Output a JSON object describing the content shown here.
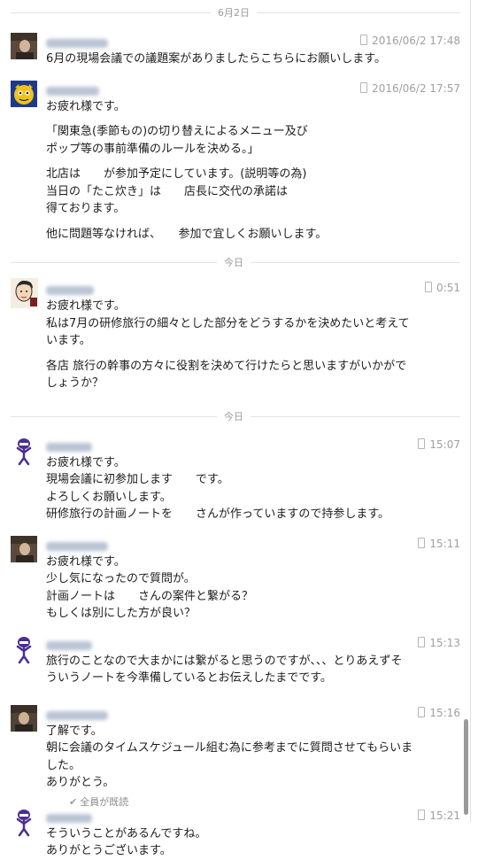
{
  "dividers": {
    "d1": "6月2日",
    "d2": "今日",
    "d3": "今日"
  },
  "messages": [
    {
      "avatar": "photo-avatar-1",
      "time": "2016/06/2 17:48",
      "paragraphs": [
        "6月の現場会議での議題案がありましたらこちらにお願いします。"
      ]
    },
    {
      "avatar": "tiger-avatar",
      "time": "2016/06/2 17:57",
      "paragraphs": [
        "お疲れ様です。",
        "「関東急(季節もの)の切り替えによるメニュー及び\nポップ等の事前準備のルールを決める。」",
        "北店は　　が参加予定にしています。(説明等の為)\n当日の「たこ炊き」は　　店長に交代の承諾は\n得ております。",
        "他に問題等なければ、　　参加で宜しくお願いします。"
      ]
    },
    {
      "avatar": "illustrated-avatar",
      "time": "0:51",
      "paragraphs": [
        "お疲れ様です。\n私は7月の研修旅行の細々とした部分をどうするかを決めたいと考えて\nいます。",
        "各店 旅行の幹事の方々に役割を決めて行けたらと思いますがいかがで\nしょうか？"
      ]
    },
    {
      "avatar": "purple-mascot-avatar",
      "time": "15:07",
      "paragraphs": [
        "お疲れ様です。\n現場会議に初参加します　　です。\nよろしくお願いします。\n研修旅行の計画ノートを　　さんが作っていますので持参します。"
      ]
    },
    {
      "avatar": "photo-avatar-2",
      "time": "15:11",
      "paragraphs": [
        "お疲れ様です。\n少し気になったので質問が。\n計画ノートは　　さんの案件と繋がる？\nもしくは別にした方が良い？"
      ]
    },
    {
      "avatar": "purple-mascot-avatar",
      "time": "15:13",
      "paragraphs": [
        "旅行のことなので大まかには繋がると思うのですが、、、とりあえずそ\nういうノートを今準備しているとお伝えしたまでです。"
      ]
    },
    {
      "avatar": "photo-avatar-3",
      "time": "15:16",
      "paragraphs": [
        "了解です。\n朝に会議のタイムスケジュール組む為に参考までに質問させてもらいま\nした。\nありがとう。"
      ]
    },
    {
      "avatar": "purple-mascot-avatar",
      "time": "15:21",
      "paragraphs": [
        "そういうことがあるんですね。\nありがとうございます。"
      ]
    }
  ],
  "read_status": "全員が既読"
}
